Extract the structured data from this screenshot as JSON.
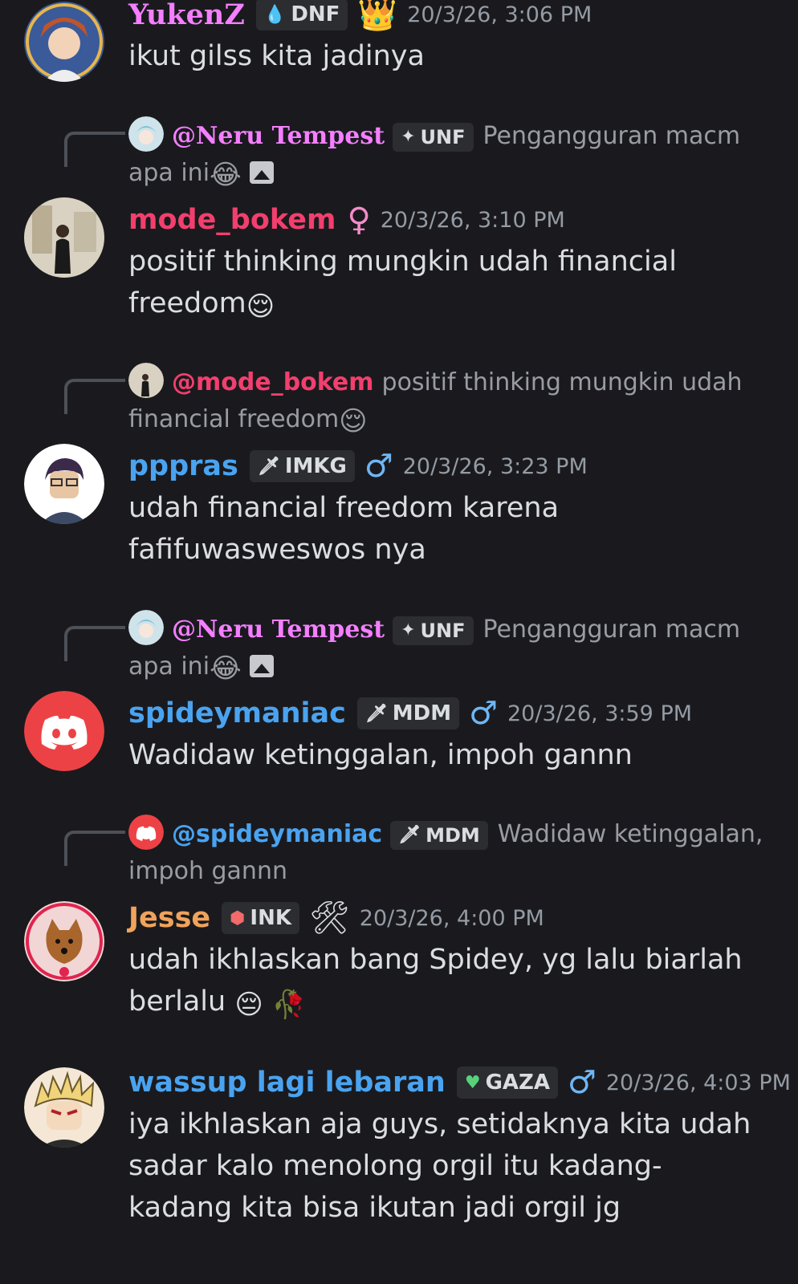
{
  "messages": [
    {
      "username": "YukenZ",
      "username_color": "#f47fff",
      "tag": {
        "icon": "water-drop-icon",
        "label": "DNF"
      },
      "extra_icon": "crown-icon",
      "timestamp": "20/3/26, 3:06 PM",
      "content": "ikut gilss kita jadinya"
    },
    {
      "reply": {
        "name": "@Neru Tempest",
        "name_color": "#f47fff",
        "tag": {
          "icon": "sparkle-icon",
          "label": "UNF"
        },
        "text": "Pengangguran macm apa ini",
        "emoji": "😂"
      },
      "username": "mode_bokem",
      "username_color": "#f23f6e",
      "extra_icon": "female-icon",
      "timestamp": "20/3/26, 3:10 PM",
      "content": "positif thinking mungkin udah financial freedom",
      "content_emoji": "😌"
    },
    {
      "reply": {
        "name": "@mode_bokem",
        "name_color": "#f23f6e",
        "text": "positif thinking mungkin udah financial freedom",
        "emoji": "😌"
      },
      "username": "pppras",
      "username_color": "#4aa3f0",
      "tag": {
        "icon": "sword-icon",
        "label": "IMKG"
      },
      "extra_icon": "male-icon",
      "timestamp": "20/3/26, 3:23 PM",
      "content": "udah financial freedom karena fafifuwasweswos nya"
    },
    {
      "reply": {
        "name": "@Neru Tempest",
        "name_color": "#f47fff",
        "tag": {
          "icon": "sparkle-icon",
          "label": "UNF"
        },
        "text": "Pengangguran macm apa ini",
        "emoji": "😂"
      },
      "username": "spideymaniac",
      "username_color": "#4aa3f0",
      "tag": {
        "icon": "sword-icon",
        "label": "MDM"
      },
      "extra_icon": "male-icon",
      "timestamp": "20/3/26, 3:59 PM",
      "content": "Wadidaw ketinggalan, impoh gannn"
    },
    {
      "reply": {
        "name": "@spideymaniac",
        "name_color": "#4aa3f0",
        "tag": {
          "icon": "sword-icon",
          "label": "MDM"
        },
        "text": "Wadidaw ketinggalan, impoh gannn"
      },
      "username": "Jesse",
      "username_color": "#f0a35b",
      "tag": {
        "icon": "red-gem-icon",
        "label": "INK"
      },
      "extra_icon": "tools-icon",
      "timestamp": "20/3/26, 4:00 PM",
      "content": "udah ikhlaskan bang Spidey, yg lalu biarlah berlalu",
      "content_emoji": "😔 🥀"
    },
    {
      "username": "wassup lagi lebaran",
      "username_color": "#4aa3f0",
      "tag": {
        "icon": "green-heart-icon",
        "label": "GAZA"
      },
      "extra_icon": "male-icon",
      "timestamp": "20/3/26, 4:03 PM",
      "content": "iya ikhlaskan aja guys, setidaknya kita udah sadar kalo menolong orgil itu kadang-kadang kita bisa ikutan jadi orgil jg"
    }
  ]
}
